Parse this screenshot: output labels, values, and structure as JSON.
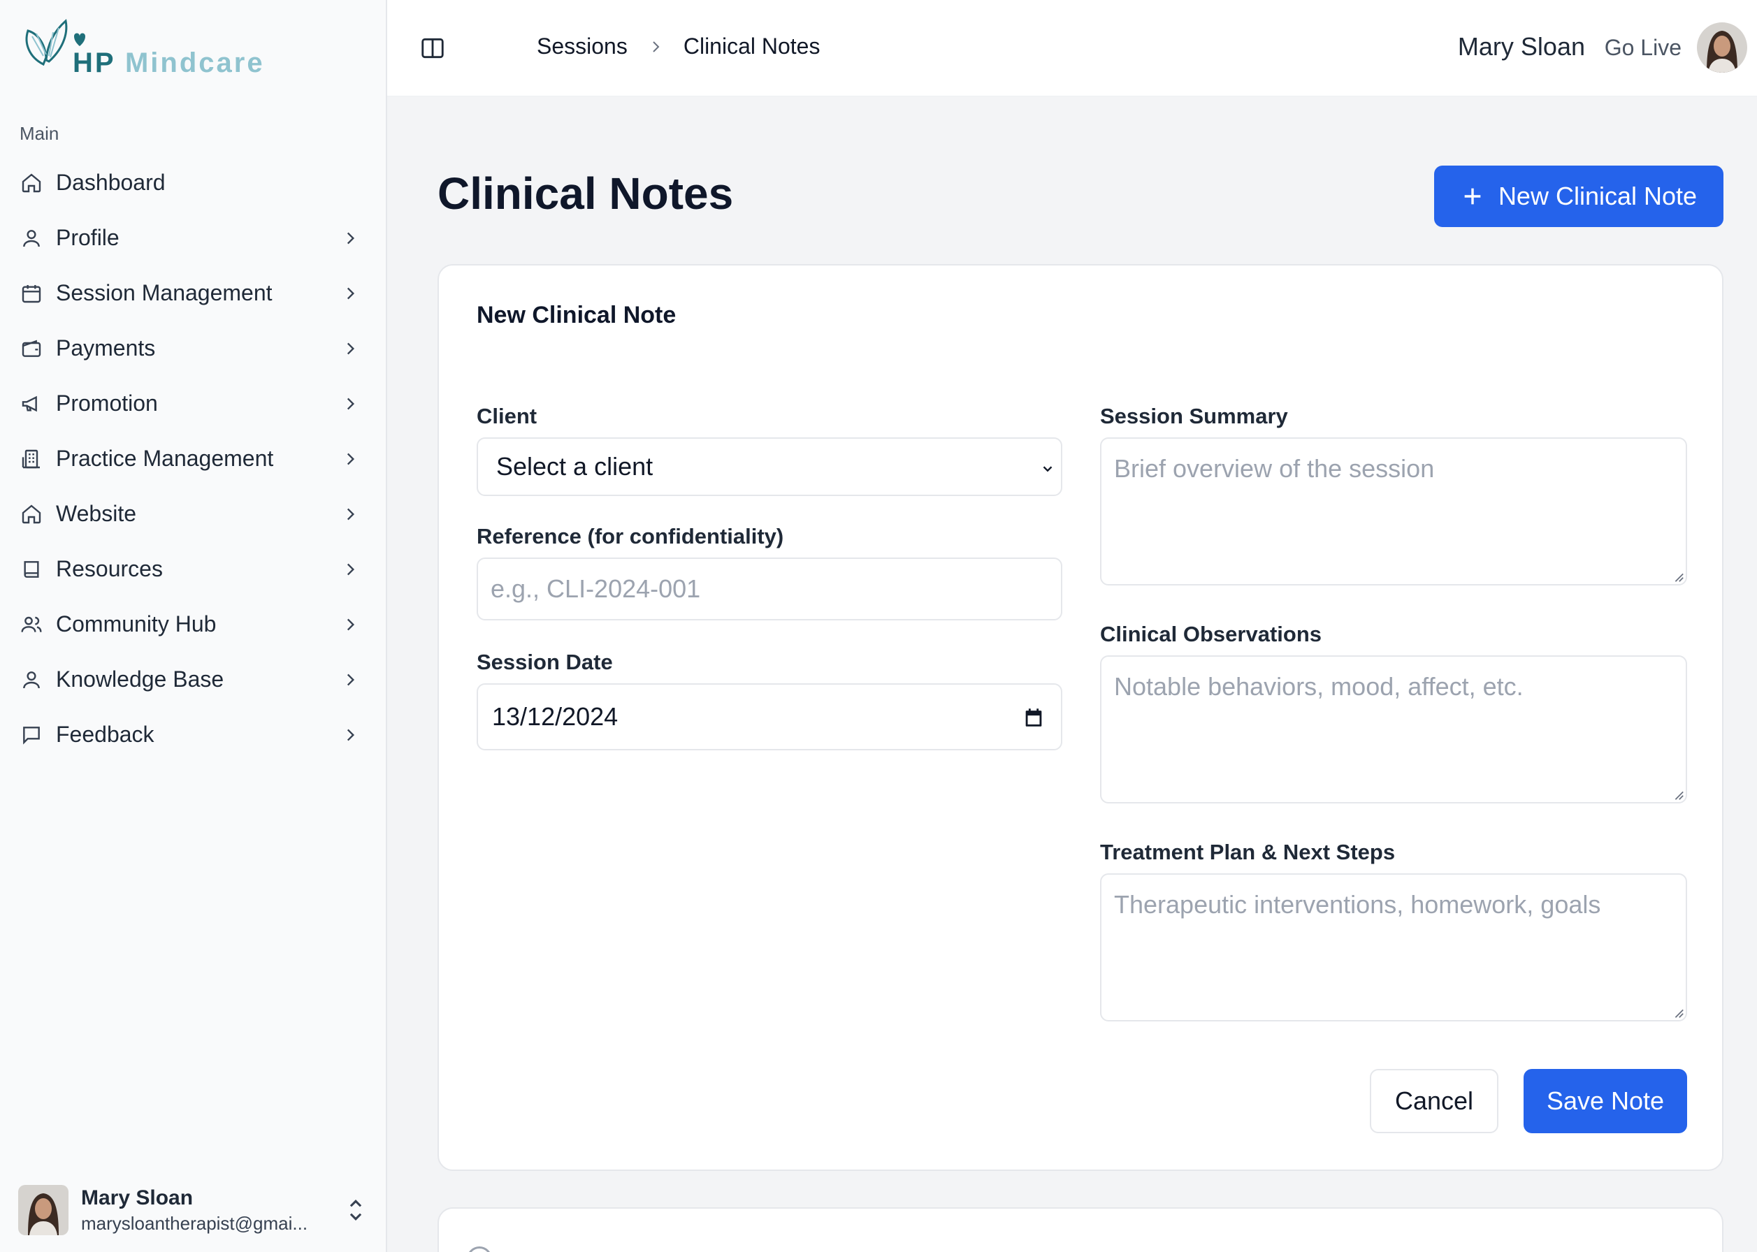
{
  "brand": {
    "name_part1": "HP",
    "name_part2": "Mindcare",
    "accent": "#2563eb",
    "logo_dark": "#1f6f7a",
    "logo_light": "#8fc3cf"
  },
  "sidebar": {
    "section_label": "Main",
    "items": [
      {
        "label": "Dashboard",
        "icon": "home-icon",
        "has_submenu": false
      },
      {
        "label": "Profile",
        "icon": "user-icon",
        "has_submenu": true
      },
      {
        "label": "Session Management",
        "icon": "calendar-icon",
        "has_submenu": true
      },
      {
        "label": "Payments",
        "icon": "wallet-icon",
        "has_submenu": true
      },
      {
        "label": "Promotion",
        "icon": "megaphone-icon",
        "has_submenu": true
      },
      {
        "label": "Practice Management",
        "icon": "building-icon",
        "has_submenu": true
      },
      {
        "label": "Website",
        "icon": "home-icon",
        "has_submenu": true
      },
      {
        "label": "Resources",
        "icon": "book-icon",
        "has_submenu": true
      },
      {
        "label": "Community Hub",
        "icon": "users-icon",
        "has_submenu": true
      },
      {
        "label": "Knowledge Base",
        "icon": "user-icon",
        "has_submenu": true
      },
      {
        "label": "Feedback",
        "icon": "message-square-icon",
        "has_submenu": true
      }
    ],
    "user": {
      "name": "Mary Sloan",
      "email": "marysloantherapist@gmai..."
    }
  },
  "topbar": {
    "breadcrumb": [
      "Sessions",
      "Clinical Notes"
    ],
    "user_name": "Mary Sloan",
    "go_live": "Go Live"
  },
  "main": {
    "title": "Clinical Notes",
    "new_button_label": "New Clinical Note"
  },
  "form": {
    "title": "New Clinical Note",
    "client": {
      "label": "Client",
      "value": "Select a client"
    },
    "reference": {
      "label": "Reference (for confidentiality)",
      "placeholder": "e.g., CLI-2024-001"
    },
    "session_date": {
      "label": "Session Date",
      "value": "13/12/2024"
    },
    "summary": {
      "label": "Session Summary",
      "placeholder": "Brief overview of the session"
    },
    "observations": {
      "label": "Clinical Observations",
      "placeholder": "Notable behaviors, mood, affect, etc."
    },
    "treatment": {
      "label": "Treatment Plan & Next Steps",
      "placeholder": "Therapeutic interventions, homework, goals"
    },
    "cancel_label": "Cancel",
    "save_label": "Save Note"
  }
}
